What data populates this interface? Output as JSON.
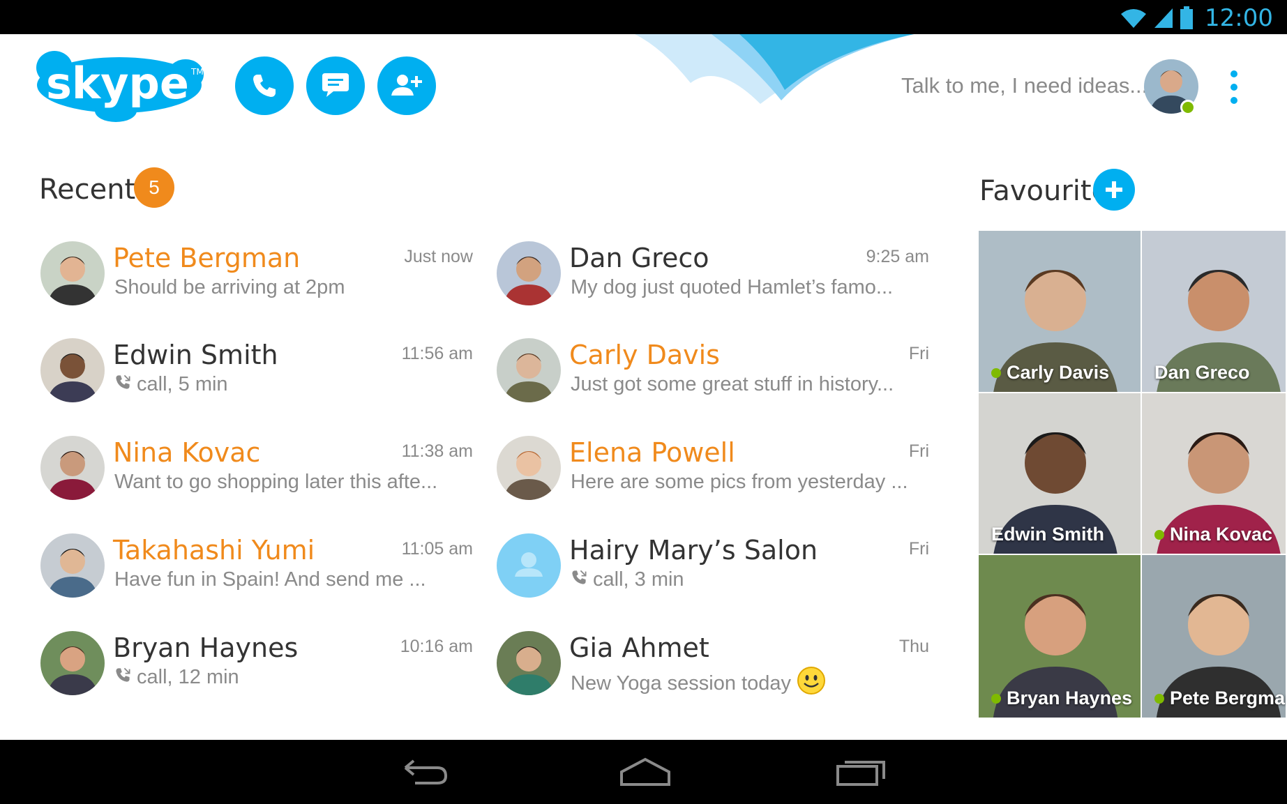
{
  "status_bar": {
    "time": "12:00",
    "icons": [
      "wifi-icon",
      "signal-icon",
      "battery-icon"
    ]
  },
  "app": {
    "logo_text": "skype",
    "accent_color": "#00aff0",
    "unread_color": "#f08a1c",
    "online_color": "#7fba00"
  },
  "header": {
    "actions": [
      {
        "name": "call",
        "icon": "phone-icon"
      },
      {
        "name": "chat",
        "icon": "chat-bubble-icon"
      },
      {
        "name": "add-contact",
        "icon": "add-person-icon"
      }
    ],
    "mood_message": "Talk to me, I need ideas...",
    "menu_icon": "overflow-menu-icon"
  },
  "recent": {
    "title": "Recent",
    "badge_count": "5",
    "conversations": [
      {
        "name": "Pete Bergman",
        "time": "Just now",
        "message": "Should be arriving at 2pm",
        "unread": true,
        "is_call": false
      },
      {
        "name": "Edwin Smith",
        "time": "11:56 am",
        "message": "call, 5 min",
        "unread": false,
        "is_call": true
      },
      {
        "name": "Nina Kovac",
        "time": "11:38 am",
        "message": "Want to go shopping later this afte...",
        "unread": true,
        "is_call": false
      },
      {
        "name": "Takahashi Yumi",
        "time": "11:05 am",
        "message": "Have fun in Spain! And send me ...",
        "unread": true,
        "is_call": false
      },
      {
        "name": "Bryan Haynes",
        "time": "10:16 am",
        "message": "call, 12 min",
        "unread": false,
        "is_call": true
      },
      {
        "name": "Dan Greco",
        "time": "9:25 am",
        "message": "My dog just quoted Hamlet’s famo...",
        "unread": false,
        "is_call": false
      },
      {
        "name": "Carly Davis",
        "time": "Fri",
        "message": "Just got some great stuff in history...",
        "unread": true,
        "is_call": false
      },
      {
        "name": "Elena Powell",
        "time": "Fri",
        "message": "Here are some pics from yesterday ...",
        "unread": true,
        "is_call": false
      },
      {
        "name": "Hairy Mary’s Salon",
        "time": "Fri",
        "message": "call, 3 min",
        "unread": false,
        "is_call": true
      },
      {
        "name": "Gia Ahmet",
        "time": "Thu",
        "message": "New Yoga session today",
        "unread": false,
        "is_call": false
      }
    ]
  },
  "favourites": {
    "title": "Favourites",
    "tiles": [
      {
        "name": "Carly Davis",
        "online": true
      },
      {
        "name": "Dan Greco",
        "online": false
      },
      {
        "name": "Edwin Smith",
        "online": false
      },
      {
        "name": "Nina Kovac",
        "online": true
      },
      {
        "name": "Bryan Haynes",
        "online": true
      },
      {
        "name": "Pete Bergman",
        "online": true
      }
    ]
  },
  "nav_bar": {
    "buttons": [
      "back-icon",
      "home-icon",
      "recent-apps-icon"
    ]
  }
}
